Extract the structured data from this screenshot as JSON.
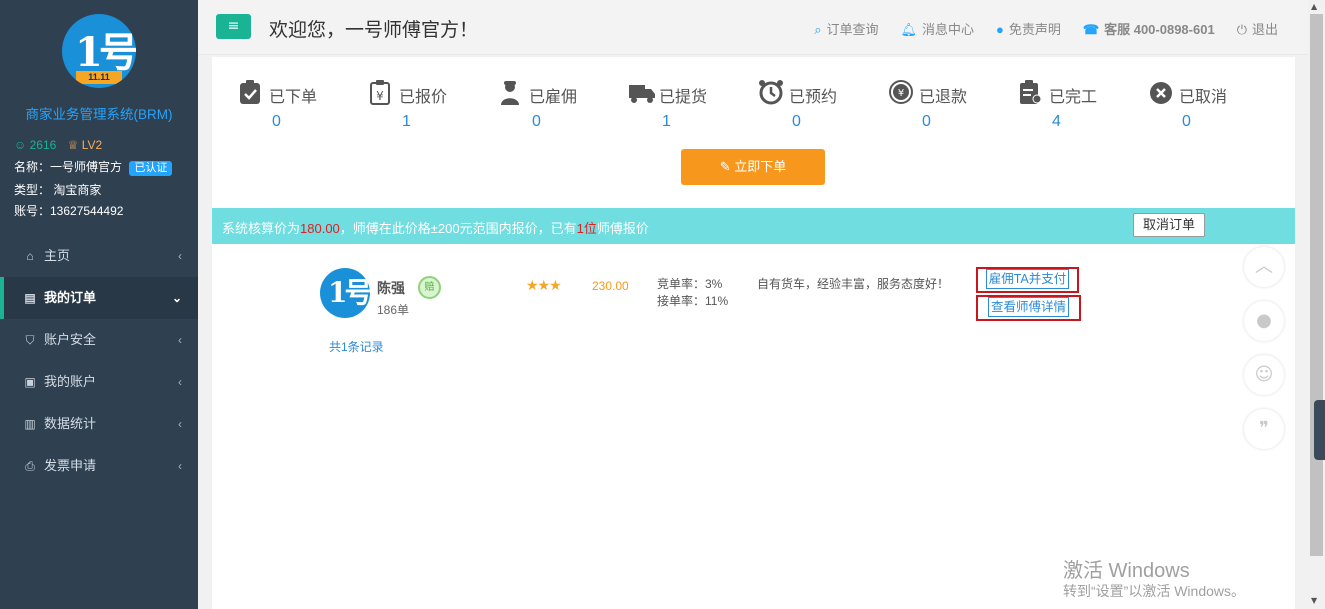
{
  "sidebar": {
    "logo_text": "1号",
    "logo_ribbon": "11.11",
    "system_name": "商家业务管理系统(BRM)",
    "points": "2616",
    "level": "LV2",
    "name_line": "名称：一号师傅官方",
    "verified": "已认证",
    "type_line": "类型： 淘宝商家",
    "account_line": "账号：13627544492",
    "menu": [
      {
        "label": "主页",
        "icon": "home-icon"
      },
      {
        "label": "我的订单",
        "icon": "orders-icon",
        "active": true
      },
      {
        "label": "账户安全",
        "icon": "shield-icon"
      },
      {
        "label": "我的账户",
        "icon": "wallet-icon"
      },
      {
        "label": "数据统计",
        "icon": "bar-chart-icon"
      },
      {
        "label": "发票申请",
        "icon": "printer-icon"
      }
    ]
  },
  "topbar": {
    "welcome": "欢迎您，一号师傅官方！",
    "links": {
      "order_query": "订单查询",
      "messages": "消息中心",
      "disclaimer": "免责声明",
      "service": "客服 400-0898-601",
      "logout": "退出"
    }
  },
  "statuses": [
    {
      "label": "已下单",
      "count": "0",
      "icon": "clipboard-check-icon"
    },
    {
      "label": "已报价",
      "count": "1",
      "icon": "yen-clipboard-icon"
    },
    {
      "label": "已雇佣",
      "count": "0",
      "icon": "worker-icon"
    },
    {
      "label": "已提货",
      "count": "1",
      "icon": "truck-icon"
    },
    {
      "label": "已预约",
      "count": "0",
      "icon": "alarm-clock-icon"
    },
    {
      "label": "已退款",
      "count": "0",
      "icon": "refund-coin-icon"
    },
    {
      "label": "已完工",
      "count": "4",
      "icon": "done-clipboard-icon"
    },
    {
      "label": "已取消",
      "count": "0",
      "icon": "cancel-circle-icon"
    }
  ],
  "order_button": "立即下单",
  "notice": {
    "prefix": "系统核算价为",
    "price": "180.00",
    "middle": "，师傅在此价格±200元范围内报价，已有",
    "count": "1位",
    "suffix": "师傅报价",
    "cancel": "取消订单"
  },
  "master": {
    "name": "陈强",
    "badge": "赔",
    "orders": "186单",
    "stars": "★★★",
    "price": "230.00",
    "bid_rate": "竞单率：3%",
    "accept_rate": "接单率：11%",
    "comment": "自有货车，经验丰富，服务态度好！",
    "hire_button": "雇佣TA并支付",
    "detail_button": "查看师傅详情"
  },
  "total": "共1条记录",
  "watermark": {
    "line1": "激活 Windows",
    "line2": "转到“设置”以激活 Windows。"
  }
}
